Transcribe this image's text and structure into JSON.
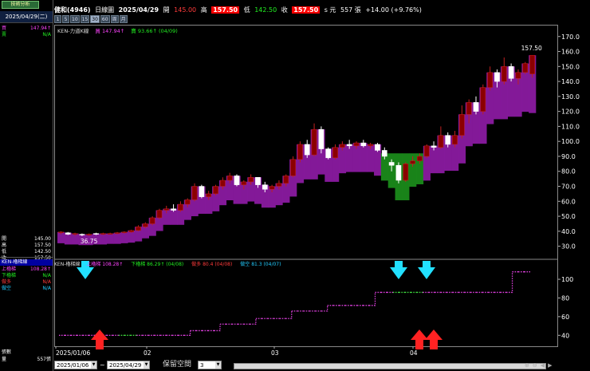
{
  "app": {
    "tab_label": "技術分析"
  },
  "left": {
    "date": "2025/04/29(二)",
    "legend_rows": [
      {
        "k": "買",
        "v": "147.94↑",
        "color": "#ff44ff"
      },
      {
        "k": "賣",
        "v": "N/A",
        "color": "#22ee22"
      }
    ],
    "ohlc_rows": [
      {
        "k": "開",
        "v": "145.00"
      },
      {
        "k": "高",
        "v": "157.50"
      },
      {
        "k": "低",
        "v": "142.50"
      },
      {
        "k": "收",
        "v": "157.50"
      }
    ],
    "indicator_title": "KEN-櫓梯線",
    "indicator_rows": [
      {
        "k": "上櫓梯",
        "v": "108.28↑",
        "color": "#ff44ff"
      },
      {
        "k": "下櫓梯",
        "v": "N/A",
        "color": "#22ee22"
      },
      {
        "k": "做多",
        "v": "N/A",
        "color": "#ff3b3b"
      },
      {
        "k": "做空",
        "v": "N/A",
        "color": "#22ccff"
      }
    ],
    "bottom_label": "張數",
    "bottom_key": "量",
    "bottom_value": "557張"
  },
  "header": {
    "stock": "健和(4946)",
    "chart_kind": "日線圖",
    "date": "2025/04/29",
    "open_label": "開",
    "open": "145.00",
    "high_label": "高",
    "high": "157.50",
    "low_label": "低",
    "low": "142.50",
    "close_label": "收",
    "close": "157.50",
    "unit": "s 元",
    "volume": "557 張",
    "change": "+14.00 (+9.76%)"
  },
  "periods": [
    "1",
    "5",
    "10",
    "15",
    "30",
    "60",
    "周",
    "月"
  ],
  "active_period": "30",
  "price_legend": {
    "name": "KEN-力道K線",
    "buy_label": "買",
    "buy_value": "147.94↑",
    "sell_label": "賣",
    "sell_value": "93.66↑ (04/09)"
  },
  "indicator_legend": {
    "name": "KEN-櫓梯線",
    "up_label": "上櫓梯",
    "up_value": "108.28↑",
    "down_label": "下櫓梯",
    "down_value": "86.29↑ (04/08)",
    "long_label": "做多",
    "long_value": "80.4 (04/08)",
    "short_label": "做空",
    "short_value": "81.3 (04/07)"
  },
  "colors": {
    "up": "#8b0000",
    "down": "#ffffff",
    "band": "#8a1aa0",
    "band_green": "#1a8a1a",
    "ladder": "#e040e0",
    "ladder_green": "#40e040",
    "arrow_down": "#22e0ff",
    "arrow_up": "#ff2222"
  },
  "bottom": {
    "from": "2025/01/06",
    "tilde": "~",
    "to": "2025/04/29",
    "keep_label": "保留空間",
    "keep_value": "3"
  },
  "chart_data": [
    {
      "type": "candlestick",
      "title": "KEN-力道K線",
      "x_labels": [
        "2025/01/06",
        "02",
        "03",
        "04"
      ],
      "y_ticks": [
        30,
        40,
        50,
        60,
        70,
        80,
        90,
        100,
        110,
        120,
        130,
        140,
        150,
        160,
        170
      ],
      "ylim": [
        25,
        172
      ],
      "annotations": [
        {
          "text": "157.50",
          "value": 157.5
        },
        {
          "text": "36.75",
          "value": 36.75
        }
      ],
      "candles": [
        {
          "o": 39,
          "h": 40,
          "l": 38,
          "c": 39.5
        },
        {
          "o": 39,
          "h": 39.5,
          "l": 37.5,
          "c": 38
        },
        {
          "o": 38,
          "h": 39,
          "l": 37,
          "c": 38.5
        },
        {
          "o": 38,
          "h": 38.5,
          "l": 36.75,
          "c": 37.5
        },
        {
          "o": 37.5,
          "h": 38.5,
          "l": 37,
          "c": 38
        },
        {
          "o": 38.5,
          "h": 39,
          "l": 37.5,
          "c": 38
        },
        {
          "o": 38,
          "h": 39,
          "l": 37.5,
          "c": 38.5
        },
        {
          "o": 38.5,
          "h": 39,
          "l": 38,
          "c": 38.5
        },
        {
          "o": 38.5,
          "h": 39.5,
          "l": 38,
          "c": 39
        },
        {
          "o": 39,
          "h": 40,
          "l": 38.5,
          "c": 39.5
        },
        {
          "o": 39.5,
          "h": 41,
          "l": 39,
          "c": 40.5
        },
        {
          "o": 40.5,
          "h": 44,
          "l": 40,
          "c": 43
        },
        {
          "o": 43,
          "h": 46,
          "l": 42,
          "c": 45
        },
        {
          "o": 45,
          "h": 50,
          "l": 44,
          "c": 49
        },
        {
          "o": 49,
          "h": 55,
          "l": 48,
          "c": 54
        },
        {
          "o": 54,
          "h": 57,
          "l": 52,
          "c": 55
        },
        {
          "o": 55,
          "h": 58,
          "l": 53,
          "c": 54
        },
        {
          "o": 54,
          "h": 60,
          "l": 53,
          "c": 58
        },
        {
          "o": 58,
          "h": 62,
          "l": 56,
          "c": 61
        },
        {
          "o": 61,
          "h": 72,
          "l": 60,
          "c": 70
        },
        {
          "o": 70,
          "h": 71,
          "l": 62,
          "c": 63
        },
        {
          "o": 63,
          "h": 67,
          "l": 61,
          "c": 65
        },
        {
          "o": 65,
          "h": 71,
          "l": 64,
          "c": 70
        },
        {
          "o": 70,
          "h": 76,
          "l": 68,
          "c": 74
        },
        {
          "o": 74,
          "h": 79,
          "l": 72,
          "c": 77
        },
        {
          "o": 77,
          "h": 78,
          "l": 70,
          "c": 71
        },
        {
          "o": 71,
          "h": 74,
          "l": 68,
          "c": 73
        },
        {
          "o": 73,
          "h": 78,
          "l": 71,
          "c": 76
        },
        {
          "o": 76,
          "h": 76,
          "l": 69,
          "c": 71
        },
        {
          "o": 71,
          "h": 73,
          "l": 66,
          "c": 68
        },
        {
          "o": 68,
          "h": 71,
          "l": 66,
          "c": 70
        },
        {
          "o": 70,
          "h": 74,
          "l": 68,
          "c": 72
        },
        {
          "o": 72,
          "h": 78,
          "l": 70,
          "c": 77
        },
        {
          "o": 77,
          "h": 90,
          "l": 76,
          "c": 88
        },
        {
          "o": 88,
          "h": 100,
          "l": 86,
          "c": 98
        },
        {
          "o": 98,
          "h": 101,
          "l": 89,
          "c": 91
        },
        {
          "o": 91,
          "h": 112,
          "l": 90,
          "c": 108
        },
        {
          "o": 108,
          "h": 110,
          "l": 92,
          "c": 95
        },
        {
          "o": 95,
          "h": 96,
          "l": 88,
          "c": 89
        },
        {
          "o": 89,
          "h": 98,
          "l": 88,
          "c": 96
        },
        {
          "o": 96,
          "h": 100,
          "l": 94,
          "c": 98
        },
        {
          "o": 98,
          "h": 101,
          "l": 95,
          "c": 97
        },
        {
          "o": 97,
          "h": 100,
          "l": 95,
          "c": 99
        },
        {
          "o": 99,
          "h": 101,
          "l": 96,
          "c": 97
        },
        {
          "o": 97,
          "h": 99,
          "l": 95,
          "c": 98
        },
        {
          "o": 98,
          "h": 99,
          "l": 93,
          "c": 94
        },
        {
          "o": 94,
          "h": 96,
          "l": 88,
          "c": 90
        },
        {
          "o": 86,
          "h": 88,
          "l": 80,
          "c": 84
        },
        {
          "o": 84,
          "h": 86,
          "l": 72,
          "c": 74
        },
        {
          "o": 74,
          "h": 86,
          "l": 73,
          "c": 85
        },
        {
          "o": 85,
          "h": 90,
          "l": 83,
          "c": 87
        },
        {
          "o": 87,
          "h": 92,
          "l": 85,
          "c": 90
        },
        {
          "o": 90,
          "h": 98,
          "l": 89,
          "c": 97
        },
        {
          "o": 97,
          "h": 100,
          "l": 94,
          "c": 96
        },
        {
          "o": 96,
          "h": 110,
          "l": 95,
          "c": 104
        },
        {
          "o": 104,
          "h": 106,
          "l": 96,
          "c": 98
        },
        {
          "o": 98,
          "h": 107,
          "l": 96,
          "c": 104
        },
        {
          "o": 104,
          "h": 124,
          "l": 102,
          "c": 118
        },
        {
          "o": 118,
          "h": 128,
          "l": 112,
          "c": 126
        },
        {
          "o": 126,
          "h": 130,
          "l": 118,
          "c": 120
        },
        {
          "o": 120,
          "h": 138,
          "l": 118,
          "c": 136
        },
        {
          "o": 136,
          "h": 150,
          "l": 134,
          "c": 146
        },
        {
          "o": 146,
          "h": 148,
          "l": 136,
          "c": 140
        },
        {
          "o": 140,
          "h": 156,
          "l": 138,
          "c": 150
        },
        {
          "o": 150,
          "h": 152,
          "l": 140,
          "c": 142
        },
        {
          "o": 142,
          "h": 148,
          "l": 138,
          "c": 146
        },
        {
          "o": 146,
          "h": 153,
          "l": 145,
          "c": 152
        },
        {
          "o": 145,
          "h": 157.5,
          "l": 142.5,
          "c": 157.5
        }
      ]
    },
    {
      "type": "line",
      "title": "KEN-櫓梯線",
      "y_ticks": [
        40,
        60,
        80,
        100
      ],
      "ylim": [
        30,
        112
      ],
      "series": [
        {
          "name": "上櫓梯",
          "values": [
            40,
            40,
            40,
            40,
            40,
            40,
            40,
            40,
            40,
            40,
            40,
            40,
            40,
            40,
            40,
            40,
            40,
            40,
            40,
            40,
            40,
            40,
            45,
            45,
            45,
            45,
            45,
            52,
            52,
            52,
            52,
            52,
            52,
            58,
            58,
            58,
            58,
            58,
            58,
            66,
            66,
            66,
            66,
            66,
            66,
            72,
            72,
            72,
            72,
            72,
            72,
            72,
            72,
            86,
            86,
            86,
            86,
            86,
            86,
            86,
            86,
            86,
            86,
            86,
            86,
            86,
            86,
            86,
            86,
            86,
            86,
            86,
            86,
            86,
            86,
            86,
            108,
            108,
            108,
            108
          ]
        }
      ],
      "down_arrows_at": [
        4,
        50,
        56
      ],
      "up_arrows_at": [
        7,
        55,
        57
      ]
    }
  ]
}
